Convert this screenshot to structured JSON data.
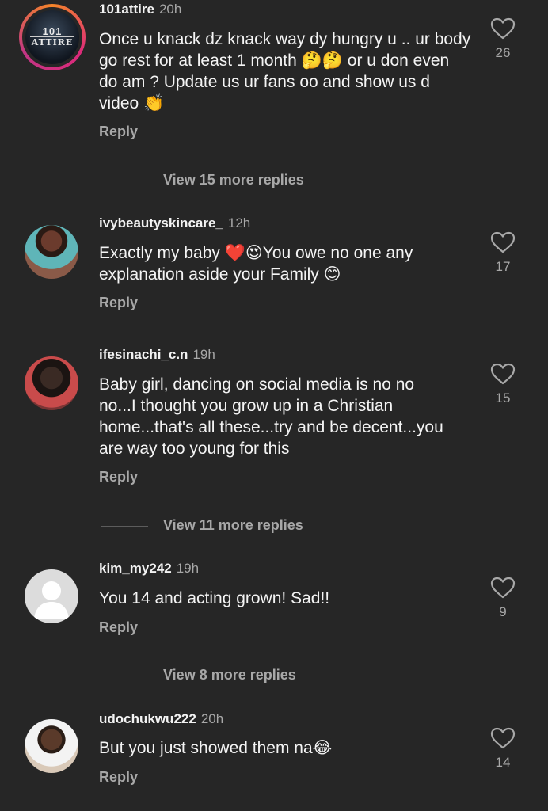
{
  "comments": [
    {
      "username": "101attire",
      "time": "20h",
      "avatar_text": [
        "101",
        "ATTIRE"
      ],
      "text": "Once u knack dz knack way dy hungry u .. ur body go rest for at least 1 month 🤔🤔 or u don even do am ? Update us ur fans oo and show us d video 👏",
      "reply": "Reply",
      "likes": "26",
      "view_more": "View 15 more replies"
    },
    {
      "username": "ivybeautyskincare_",
      "time": "12h",
      "text": "Exactly my baby ❤️😍You owe no one any explanation aside your Family 😊",
      "reply": "Reply",
      "likes": "17"
    },
    {
      "username": "ifesinachi_c.n",
      "time": "19h",
      "text": "Baby girl, dancing on social media is no no no...I thought you grow up in a Christian home...that's all these...try and be decent...you are way too young for this",
      "reply": "Reply",
      "likes": "15",
      "view_more": "View 11 more replies"
    },
    {
      "username": "kim_my242",
      "time": "19h",
      "text": "You 14 and acting grown! Sad!!",
      "reply": "Reply",
      "likes": "9",
      "view_more": "View 8 more replies"
    },
    {
      "username": "udochukwu222",
      "time": "20h",
      "text": "But you just showed them na😂",
      "reply": "Reply",
      "likes": "14"
    }
  ],
  "colors": {
    "background": "#262626",
    "primary_text": "#f2f2f2",
    "secondary_text": "#a8a8a8"
  },
  "icons": {
    "like": "heart-outline-icon",
    "default_avatar": "person-silhouette-icon"
  }
}
